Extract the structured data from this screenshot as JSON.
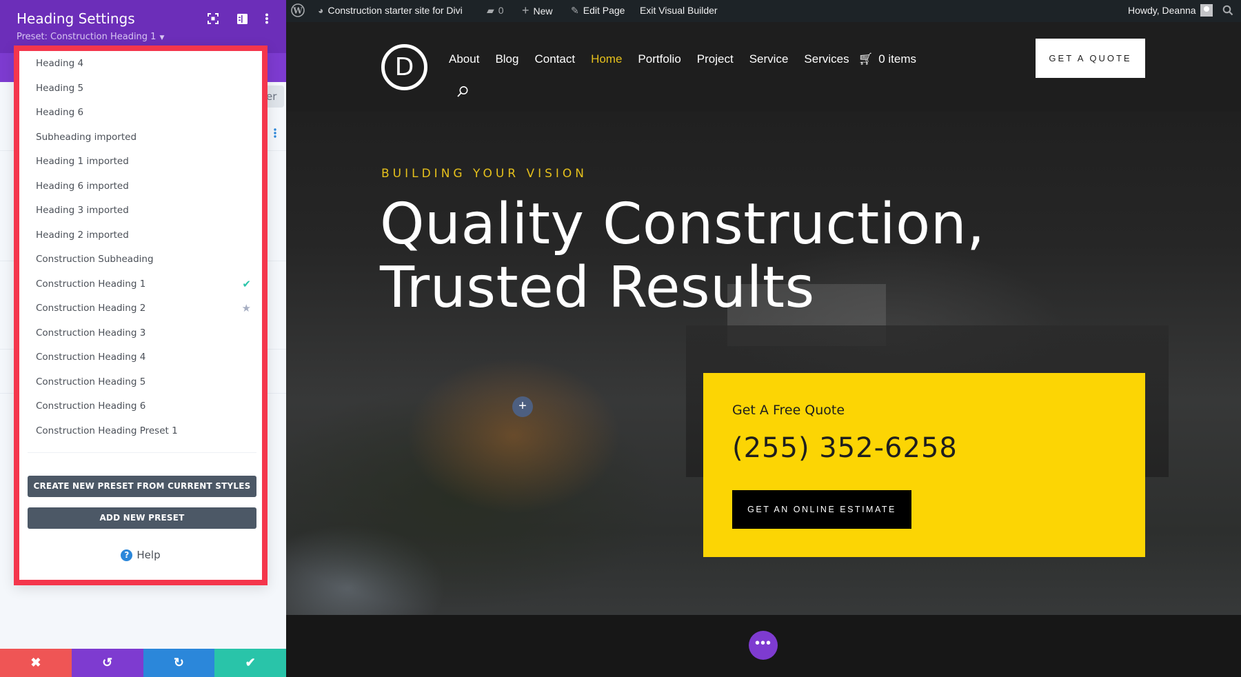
{
  "sidebar": {
    "title": "Heading Settings",
    "preset_label": "Preset: Construction Heading 1",
    "filter_button_partial": "er",
    "icons": {
      "fullscreen": "fullscreen-icon",
      "layout": "sidebar-layout-icon",
      "more": "kebab-menu-icon"
    },
    "actions": {
      "cancel": "✖",
      "undo": "↺",
      "redo": "↻",
      "save": "✔"
    }
  },
  "preset_dropdown": {
    "items": [
      {
        "label": "Heading 4"
      },
      {
        "label": "Heading 5"
      },
      {
        "label": "Heading 6"
      },
      {
        "label": "Subheading imported"
      },
      {
        "label": "Heading 1 imported"
      },
      {
        "label": "Heading 6 imported"
      },
      {
        "label": "Heading 3 imported"
      },
      {
        "label": "Heading 2 imported"
      },
      {
        "label": "Construction Subheading"
      },
      {
        "label": "Construction Heading 1",
        "mark": "✔",
        "status": "active"
      },
      {
        "label": "Construction Heading 2",
        "mark": "★",
        "status": "default"
      },
      {
        "label": "Construction Heading 3"
      },
      {
        "label": "Construction Heading 4"
      },
      {
        "label": "Construction Heading 5"
      },
      {
        "label": "Construction Heading 6"
      },
      {
        "label": "Construction Heading Preset 1"
      }
    ],
    "create_button": "CREATE NEW PRESET FROM CURRENT STYLES",
    "add_button": "ADD NEW PRESET",
    "help_label": "Help",
    "help_icon": "?"
  },
  "adminbar": {
    "site_name": "Construction starter site for Divi",
    "comments_count": "0",
    "new_label": "New",
    "edit_label": "Edit Page",
    "exit_label": "Exit Visual Builder",
    "greeting": "Howdy, Deanna"
  },
  "site": {
    "logo_letter": "D",
    "nav": [
      "About",
      "Blog",
      "Contact",
      "Home",
      "Portfolio",
      "Project",
      "Service",
      "Services"
    ],
    "active_nav": "Home",
    "cart_label": "0 items",
    "quote_button": "GET A QUOTE",
    "eyebrow": "BUILDING YOUR VISION",
    "hero_line1": "Quality Construction,",
    "hero_line2": "Trusted Results",
    "quote_box": {
      "label": "Get A Free Quote",
      "phone": "(255) 352-6258",
      "button": "GET AN ONLINE ESTIMATE"
    },
    "add_symbol": "+",
    "more_symbol": "•••"
  },
  "colors": {
    "divi_purple": "#6c2eb9",
    "highlight_red": "#f4364c",
    "accent_yellow": "#fcd504",
    "nav_active": "#e5c01c",
    "save_green": "#29c4a9",
    "redo_blue": "#2b87da",
    "cancel_red": "#ef5555"
  }
}
